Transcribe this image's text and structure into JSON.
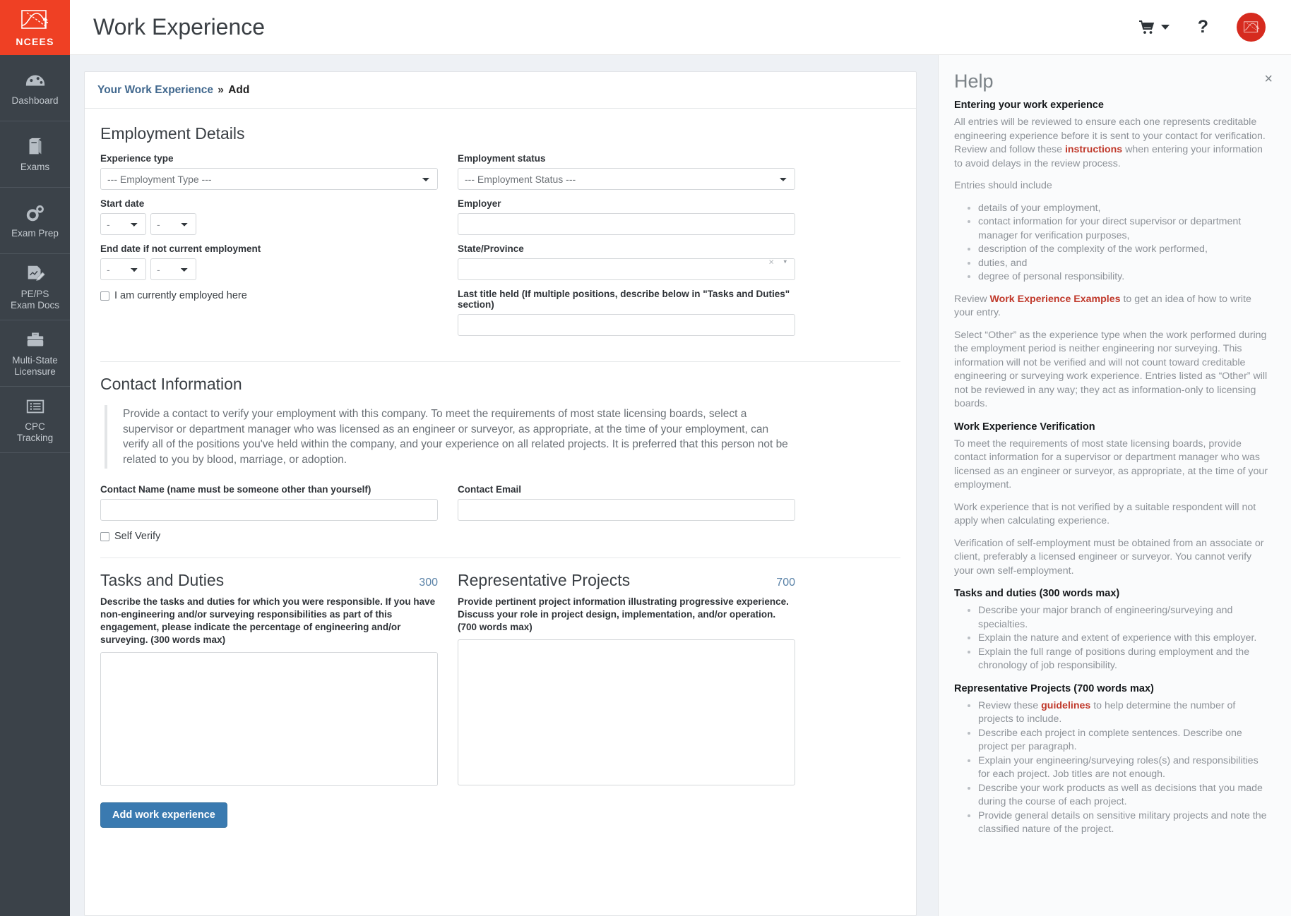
{
  "brand": {
    "name": "NCEES",
    "accent": "#ef4024",
    "sidebar_bg": "#3b4249"
  },
  "sidebar": {
    "items": [
      {
        "label": "Dashboard",
        "icon": "dashboard-icon"
      },
      {
        "label": "Exams",
        "icon": "books-icon"
      },
      {
        "label": "Exam Prep",
        "icon": "gears-icon"
      },
      {
        "label": "PE/PS\nExam Docs",
        "icon": "document-pencil-icon"
      },
      {
        "label": "Multi-State\nLicensure",
        "icon": "briefcase-icon"
      },
      {
        "label": "CPC\nTracking",
        "icon": "list-icon"
      }
    ]
  },
  "header": {
    "title": "Work Experience",
    "cart_icon": "shopping-cart-icon",
    "help_icon": "question-mark-icon",
    "avatar_icon": "user-avatar-icon"
  },
  "breadcrumb": {
    "link": "Your Work Experience",
    "separator": "»",
    "current": "Add"
  },
  "employment": {
    "section_title": "Employment Details",
    "experience_type_label": "Experience type",
    "experience_type_value": "--- Employment Type ---",
    "employment_status_label": "Employment status",
    "employment_status_value": "--- Employment Status ---",
    "start_date_label": "Start date",
    "start_month_value": "-",
    "start_year_value": "-",
    "employer_label": "Employer",
    "employer_value": "",
    "end_date_label": "End date if not current employment",
    "end_month_value": "-",
    "end_year_value": "-",
    "state_province_label": "State/Province",
    "state_province_value": "",
    "state_clear_icon": "×",
    "state_caret_icon": "▾",
    "currently_employed_label": "I am currently employed here",
    "last_title_label": "Last title held (If multiple positions, describe below in \"Tasks and Duties\" section)",
    "last_title_value": ""
  },
  "contact": {
    "section_title": "Contact Information",
    "blurb": "Provide a contact to verify your employment with this company. To meet the requirements of most state licensing boards, select a supervisor or department manager who was licensed as an engineer or surveyor, as appropriate, at the time of your employment, can verify all of the positions you've held within the company, and your experience on all related projects. It is preferred that this person not be related to you by blood, marriage, or adoption.",
    "contact_name_label": "Contact Name (name must be someone other than yourself)",
    "contact_name_value": "",
    "contact_email_label": "Contact Email",
    "contact_email_value": "",
    "self_verify_label": "Self Verify"
  },
  "tasks": {
    "title": "Tasks and Duties",
    "counter": "300",
    "hint": "Describe the tasks and duties for which you were responsible. If you have non-engineering and/or surveying responsibilities as part of this engagement, please indicate the percentage of engineering and/or surveying. (300 words max)",
    "value": ""
  },
  "projects": {
    "title": "Representative Projects",
    "counter": "700",
    "hint": "Provide pertinent project information illustrating progressive experience. Discuss your role in project design, implementation, and/or operation. (700 words max)",
    "value": ""
  },
  "submit": {
    "label": "Add work experience"
  },
  "help": {
    "title": "Help",
    "close_icon": "×",
    "h1": "Entering your work experience",
    "p1_a": "All entries will be reviewed to ensure each one represents creditable engineering experience before it is sent to your contact for verification. Review and follow these ",
    "p1_link": "instructions",
    "p1_b": " when entering your information to avoid delays in the review process.",
    "p2": "Entries should include",
    "list1": [
      "details of your employment,",
      "contact information for your direct supervisor or department manager for verification purposes,",
      "description of the complexity of the work performed,",
      "duties, and",
      "degree of personal responsibility."
    ],
    "p3_a": "Review ",
    "p3_link": "Work Experience Examples",
    "p3_b": " to get an idea of how to write your entry.",
    "p4": "Select “Other” as the experience type when the work performed during the employment period is neither engineering nor surveying. This information will not be verified and will not count toward creditable engineering or surveying work experience. Entries listed as “Other” will not be reviewed in any way; they act as information-only to licensing boards.",
    "h2": "Work Experience Verification",
    "p5": "To meet the requirements of most state licensing boards, provide contact information for a supervisor or department manager who was licensed as an engineer or surveyor, as appropriate, at the time of your employment.",
    "p6": "Work experience that is not verified by a suitable respondent will not apply when calculating experience.",
    "p7": "Verification of self-employment must be obtained from an associate or client, preferably a licensed engineer or surveyor. You cannot verify your own self-employment.",
    "h3": "Tasks and duties (300 words max)",
    "list2": [
      "Describe your major branch of engineering/surveying and specialties.",
      "Explain the nature and extent of experience with this employer.",
      "Explain the full range of positions during employment and the chronology of job responsibility."
    ],
    "h4": "Representative Projects (700 words max)",
    "list3_1_a": "Review these ",
    "list3_1_link": "guidelines",
    "list3_1_b": " to help determine the number of projects to include.",
    "list3_rest": [
      "Describe each project in complete sentences. Describe one project per paragraph.",
      "Explain your engineering/surveying roles(s) and responsibilities for each project. Job titles are not enough.",
      "Describe your work products as well as decisions that you made during the course of each project.",
      "Provide general details on sensitive military projects and note the classified nature of the project."
    ]
  }
}
